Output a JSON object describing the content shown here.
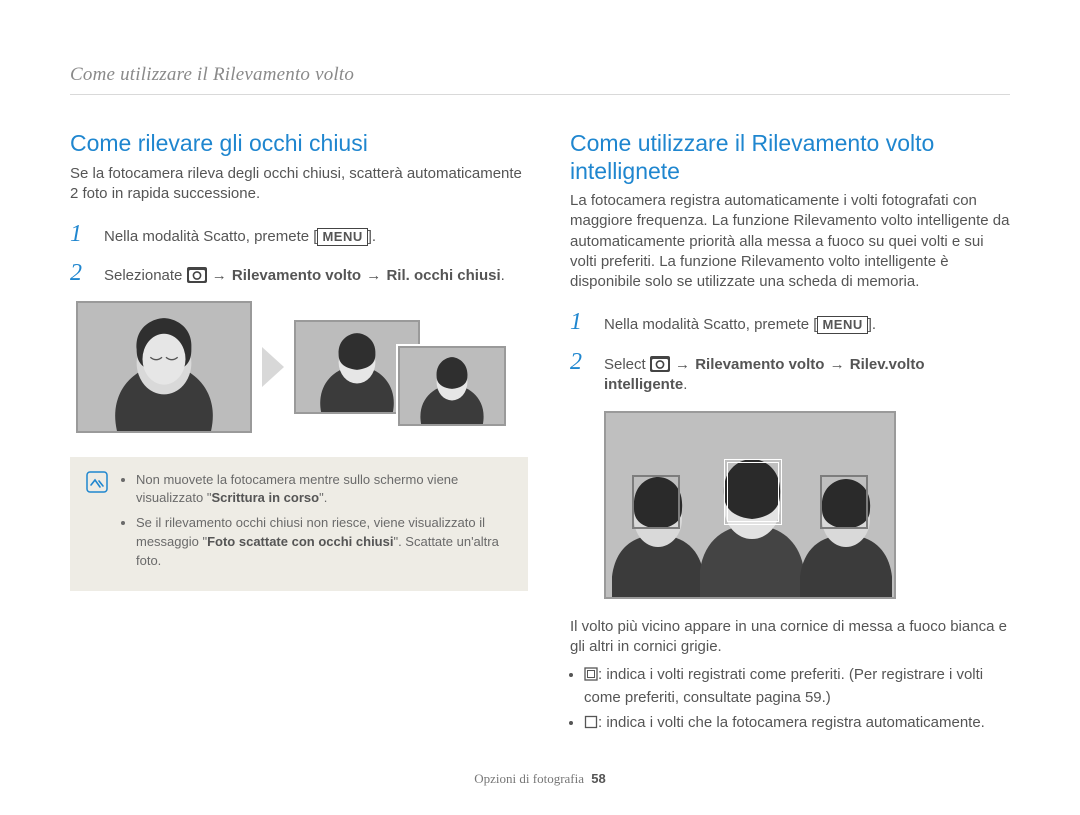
{
  "header": {
    "breadcrumb": "Come utilizzare il Rilevamento volto"
  },
  "left": {
    "title": "Come rilevare gli occhi chiusi",
    "intro": "Se la fotocamera rileva degli occhi chiusi, scatterà automaticamente 2 foto in rapida successione.",
    "step1_prefix": "Nella modalità Scatto, premete [",
    "step1_menu": "MENU",
    "step1_suffix": "].",
    "step2_prefix": "Selezionate ",
    "step2_path_a": "Rilevamento volto",
    "step2_path_b": "Ril. occhi chiusi",
    "note_bullet1_a": "Non muovete la fotocamera mentre sullo schermo viene visualizzato ",
    "note_bullet1_q1": "\"",
    "note_bullet1_hl": "Scrittura in corso",
    "note_bullet1_q2": "\".",
    "note_bullet2_a": "Se il rilevamento occhi chiusi non riesce, viene visualizzato il messaggio \"",
    "note_bullet2_hl": "Foto scattate con occhi chiusi",
    "note_bullet2_b": "\". Scattate un'altra foto."
  },
  "right": {
    "title": "Come utilizzare il Rilevamento volto intellignete",
    "intro": "La fotocamera registra automaticamente i volti fotografati con maggiore frequenza. La funzione Rilevamento volto intelligente da automaticamente priorità alla messa a fuoco su quei volti e sui volti preferiti. La funzione Rilevamento volto intelligente è disponibile solo se utilizzate una scheda di memoria.",
    "step1_prefix": "Nella modalità Scatto, premete [",
    "step1_menu": "MENU",
    "step1_suffix": "].",
    "step2_prefix": "Select ",
    "step2_path_a": "Rilevamento volto",
    "step2_path_b": "Rilev.volto intelligente",
    "caption": "Il volto più vicino appare in una cornice di messa a fuoco bianca e gli altri in cornici grigie.",
    "bullet1": ": indica i volti registrati come preferiti. (Per registrare i volti come preferiti, consultate pagina 59.)",
    "bullet2": ": indica i volti che la fotocamera registra automaticamente."
  },
  "footer": {
    "section": "Opzioni di fotografia",
    "page": "58"
  },
  "icons": {
    "camera": "camera-icon",
    "arrow": "→"
  }
}
